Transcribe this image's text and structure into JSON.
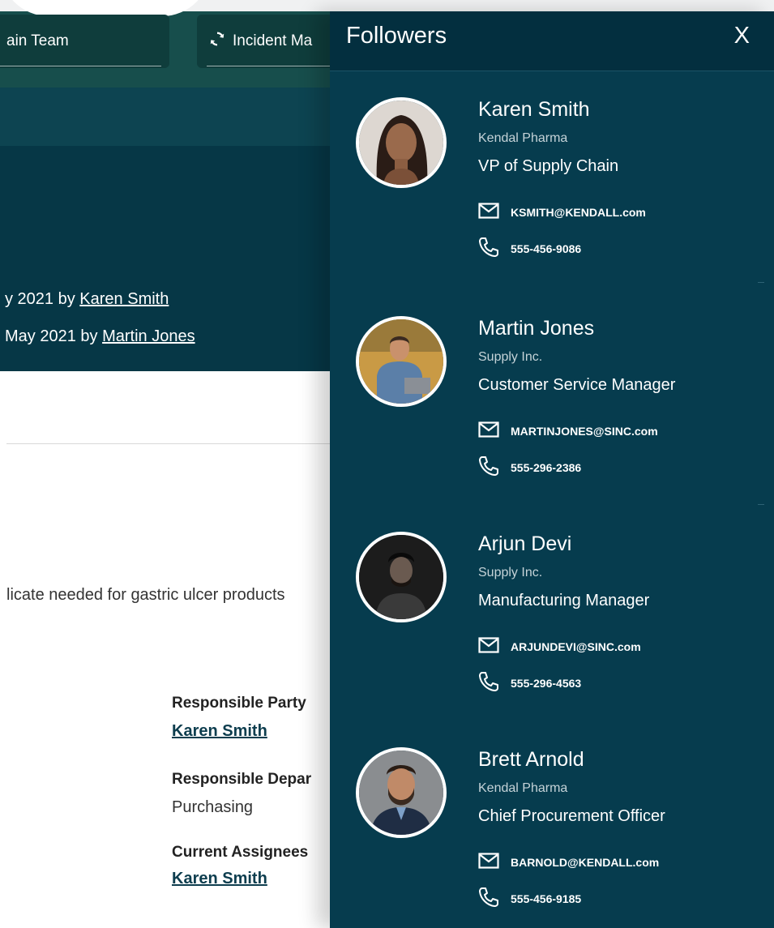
{
  "background_page": {
    "tabs": [
      {
        "label": "ain Team"
      },
      {
        "label": "Incident Ma",
        "icon": "sync-icon"
      }
    ],
    "history": [
      {
        "prefix": "y 2021 by ",
        "user": "Karen Smith"
      },
      {
        "prefix": "May 2021 by ",
        "user": "Martin Jones"
      }
    ],
    "description": "licate needed for gastric ulcer products",
    "fields": {
      "responsible_party": {
        "label": "Responsible Party",
        "value": "Karen Smith"
      },
      "responsible_department": {
        "label": "Responsible Depar",
        "value": "Purchasing"
      },
      "current_assignees": {
        "label": "Current Assignees",
        "value": "Karen Smith"
      }
    }
  },
  "followers_panel": {
    "title": "Followers",
    "close_label": "X",
    "followers": [
      {
        "name": "Karen Smith",
        "company": "Kendal Pharma",
        "role": "VP of Supply Chain",
        "email": "KSMITH@KENDALL.com",
        "phone": "555-456-9086"
      },
      {
        "name": "Martin Jones",
        "company": "Supply Inc.",
        "role": "Customer Service Manager",
        "email": "MARTINJONES@SINC.com",
        "phone": "555-296-2386"
      },
      {
        "name": "Arjun Devi",
        "company": "Supply Inc.",
        "role": "Manufacturing Manager",
        "email": "ARJUNDEVI@SINC.com",
        "phone": "555-296-4563"
      },
      {
        "name": "Brett Arnold",
        "company": "Kendal Pharma",
        "role": "Chief Procurement Officer",
        "email": "BARNOLD@KENDALL.com",
        "phone": "555-456-9185"
      }
    ]
  },
  "icons": {
    "email": "envelope-icon",
    "phone": "phone-icon",
    "tab": "sync-icon"
  },
  "colors": {
    "panel_background": "#063c4e",
    "panel_header": "#032f3f",
    "top_bar": "#174e4c",
    "hero": "#063746",
    "link": "#0d3d4e"
  }
}
